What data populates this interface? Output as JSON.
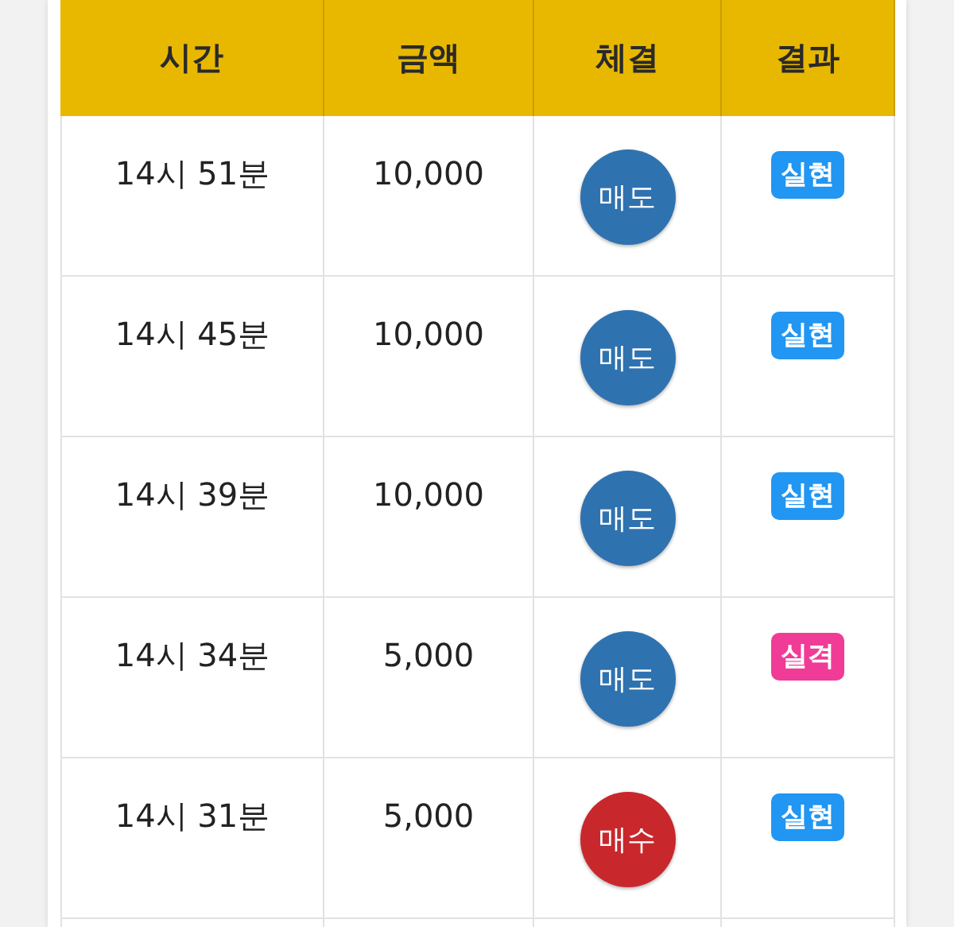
{
  "table": {
    "columns": [
      "시간",
      "금액",
      "체결",
      "결과"
    ],
    "rows": [
      {
        "time": "14시 51분",
        "amount": "10,000",
        "trade": {
          "label": "매도",
          "kind": "sell"
        },
        "result": {
          "label": "실현",
          "color": "#2196f3"
        }
      },
      {
        "time": "14시 45분",
        "amount": "10,000",
        "trade": {
          "label": "매도",
          "kind": "sell"
        },
        "result": {
          "label": "실현",
          "color": "#2196f3"
        }
      },
      {
        "time": "14시 39분",
        "amount": "10,000",
        "trade": {
          "label": "매도",
          "kind": "sell"
        },
        "result": {
          "label": "실현",
          "color": "#2196f3"
        }
      },
      {
        "time": "14시 34분",
        "amount": "5,000",
        "trade": {
          "label": "매도",
          "kind": "sell"
        },
        "result": {
          "label": "실격",
          "color": "#f03c96"
        }
      },
      {
        "time": "14시 31분",
        "amount": "5,000",
        "trade": {
          "label": "매수",
          "kind": "buy"
        },
        "result": {
          "label": "실현",
          "color": "#2196f3"
        }
      }
    ]
  }
}
